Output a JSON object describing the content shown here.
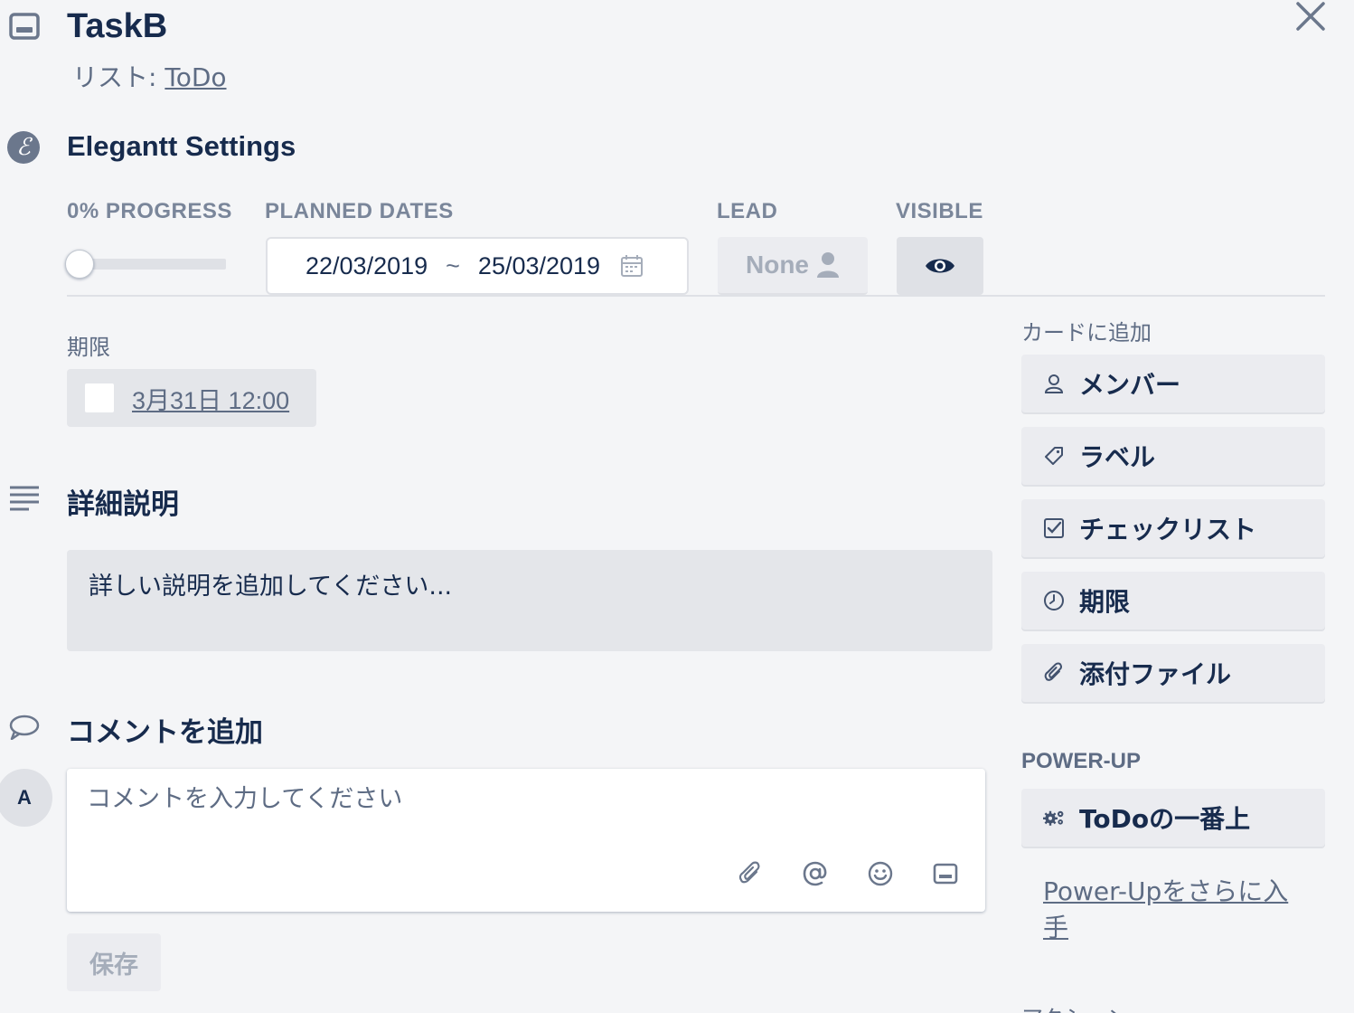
{
  "card": {
    "title": "TaskB",
    "list_prefix": "リスト: ",
    "list_name": "ToDo"
  },
  "elegantt": {
    "title": "Elegantt Settings",
    "progress_label": "0% PROGRESS",
    "progress_value": 0,
    "planned_label": "PLANNED DATES",
    "start_date": "22/03/2019",
    "separator": "~",
    "end_date": "25/03/2019",
    "lead_label": "LEAD",
    "lead_value": "None",
    "visible_label": "VISIBLE"
  },
  "due": {
    "caption": "期限",
    "value": "3月31日 12:00"
  },
  "description": {
    "title": "詳細説明",
    "placeholder": "詳しい説明を追加してください..."
  },
  "comment": {
    "title": "コメントを追加",
    "avatar_initial": "A",
    "placeholder": "コメントを入力してください",
    "save_label": "保存"
  },
  "sidebar": {
    "add_caption": "カードに追加",
    "buttons": [
      {
        "label": "メンバー",
        "icon": "person-icon"
      },
      {
        "label": "ラベル",
        "icon": "tag-icon"
      },
      {
        "label": "チェックリスト",
        "icon": "checklist-icon"
      },
      {
        "label": "期限",
        "icon": "clock-icon"
      },
      {
        "label": "添付ファイル",
        "icon": "paperclip-icon"
      }
    ],
    "powerup_caption": "POWER-UP",
    "powerup_button": "ToDoの一番上",
    "powerup_link": "Power-Upをさらに入手",
    "actions_caption_partial": "アクション"
  },
  "colors": {
    "background": "#f4f5f7",
    "text": "#172b4d",
    "muted": "#5e6c84",
    "button_bg": "#ebecf0"
  }
}
